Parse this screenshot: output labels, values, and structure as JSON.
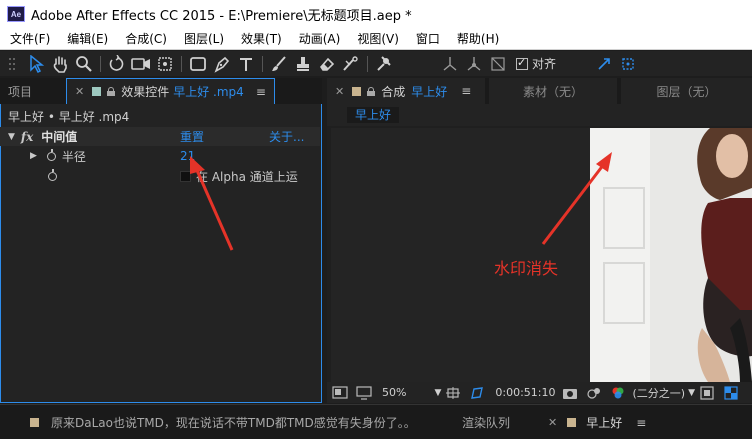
{
  "window": {
    "title": "Adobe After Effects CC 2015 - E:\\Premiere\\无标题项目.aep *",
    "logo_text": "Ae"
  },
  "menu": [
    "文件(F)",
    "编辑(E)",
    "合成(C)",
    "图层(L)",
    "效果(T)",
    "动画(A)",
    "视图(V)",
    "窗口",
    "帮助(H)"
  ],
  "toolbar": {
    "snap_label": "对齐",
    "snap_checked": true
  },
  "left_panel": {
    "tab_project": "项目",
    "tab_effects_prefix": "效果控件",
    "tab_effects_layer": "早上好 .mp4",
    "breadcrumb": "早上好 • 早上好 .mp4",
    "effect": {
      "fx": "fx",
      "name": "中间值",
      "reset": "重置",
      "about": "关于..."
    },
    "properties": [
      {
        "label": "半径",
        "value": "21"
      },
      {
        "label": "在 Alpha 通道上运",
        "value": ""
      }
    ]
  },
  "right_panel": {
    "tab_comp_prefix": "合成",
    "tab_comp_name": "早上好",
    "tab_footage": "素材（无）",
    "tab_layer": "图层（无）",
    "comp_crumb": "早上好",
    "zoom": "50%",
    "timecode": "0:00:51:10",
    "resolution": "(二分之一)"
  },
  "bottom_bar": {
    "item1": "原来DaLao也说TMD，现在说话不带TMD都TMD感觉有失身份了。。",
    "render_queue": "渲染队列",
    "timeline_name": "早上好"
  },
  "annotation": {
    "text": "水印消失",
    "color": "#e53328"
  },
  "colors": {
    "accent_blue": "#2d8ceb",
    "label_tan": "#c9b48f",
    "label_teal": "#9ec9c0"
  }
}
